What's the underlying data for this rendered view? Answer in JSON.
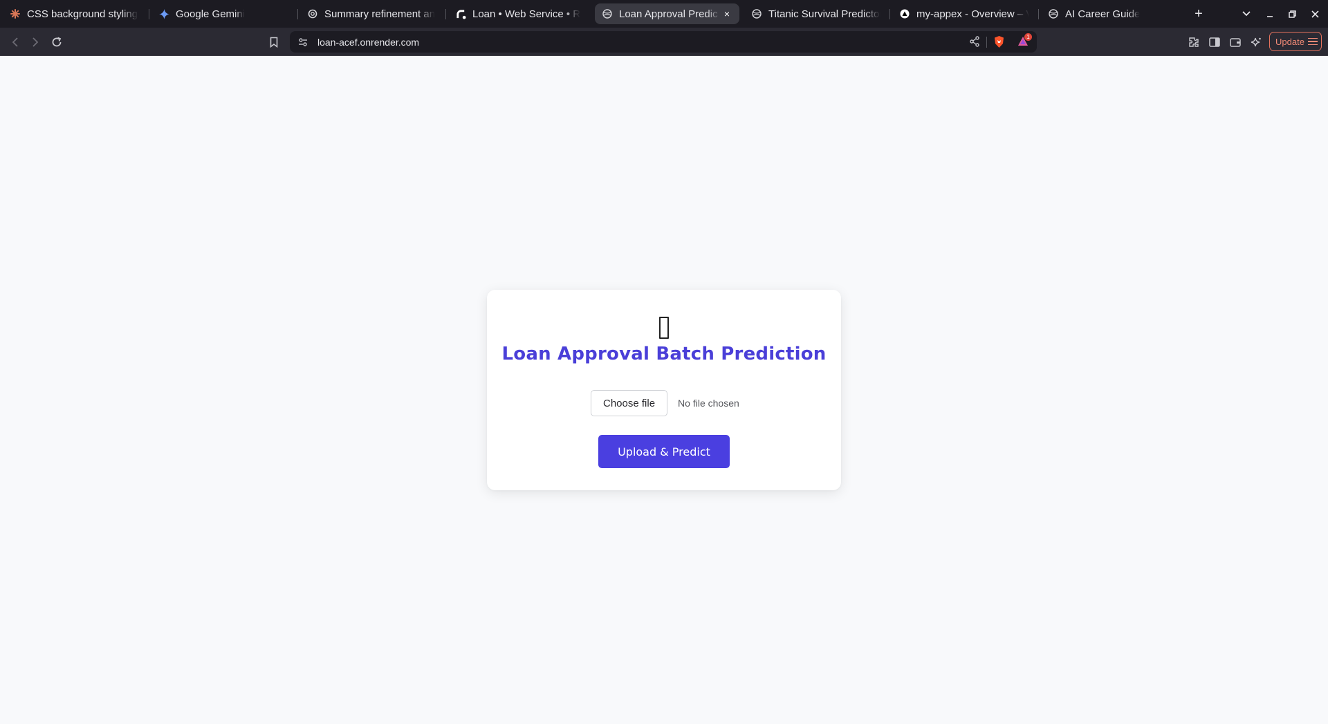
{
  "browser": {
    "tabs": [
      {
        "title": "CSS background styling f",
        "icon": "claude-icon",
        "active": false
      },
      {
        "title": "Google Gemini",
        "icon": "gemini-icon",
        "active": false
      },
      {
        "title": "Summary refinement an",
        "icon": "chatgpt-icon",
        "active": false
      },
      {
        "title": "Loan  •  Web Service  •  R",
        "icon": "render-icon",
        "active": false
      },
      {
        "title": "Loan Approval Predic",
        "icon": "globe-icon",
        "active": true
      },
      {
        "title": "Titanic Survival Predictor",
        "icon": "globe-icon",
        "active": false
      },
      {
        "title": "my-appex - Overview – V",
        "icon": "vercel-icon",
        "active": false
      },
      {
        "title": "AI Career Guide",
        "icon": "globe-icon",
        "active": false
      }
    ],
    "new_tab_symbol": "+",
    "close_tab_symbol": "×",
    "url": "loan-acef.onrender.com",
    "update_label": "Update",
    "notification_count": "1",
    "colors": {
      "chrome_bg": "#1c1b22",
      "toolbar_bg": "#2b2a33",
      "update_accent": "#f08a76"
    }
  },
  "page": {
    "emoji_placeholder": "",
    "title": "Loan Approval Batch Prediction",
    "file_input": {
      "button_label": "Choose file",
      "status": "No file chosen"
    },
    "submit_label": "Upload & Predict",
    "colors": {
      "accent": "#4a3fe0",
      "title": "#4a3fd8",
      "background": "#f8f9fb"
    }
  }
}
